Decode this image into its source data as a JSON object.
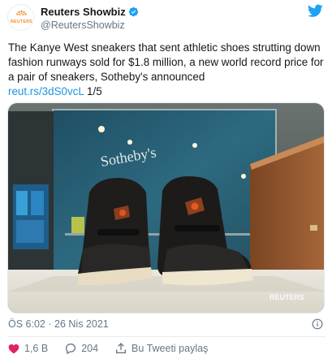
{
  "header": {
    "display_name": "Reuters Showbiz",
    "handle": "@ReutersShowbiz",
    "avatar_text": "REUTERS",
    "verified_icon": "verified-badge-icon",
    "platform_icon": "twitter-bird-icon"
  },
  "tweet": {
    "text": "The Kanye West sneakers that sent athletic shoes strutting down fashion runways sold for $1.8 million, a new world record price for a pair of sneakers, Sotheby's announced",
    "link": "reut.rs/3dS0vcL",
    "counter": "1/5"
  },
  "media": {
    "store_sign": "Sotheby's",
    "watermark": "REUTERS"
  },
  "meta": {
    "time": "ÖS 6:02",
    "separator": "·",
    "date": "26 Nis 2021"
  },
  "actions": {
    "likes": "1,6 B",
    "replies": "204",
    "share_label": "Bu Tweeti paylaş"
  },
  "colors": {
    "accent": "#1da1f2",
    "link": "#1b95e0",
    "like": "#e0245e",
    "muted": "#657786"
  }
}
